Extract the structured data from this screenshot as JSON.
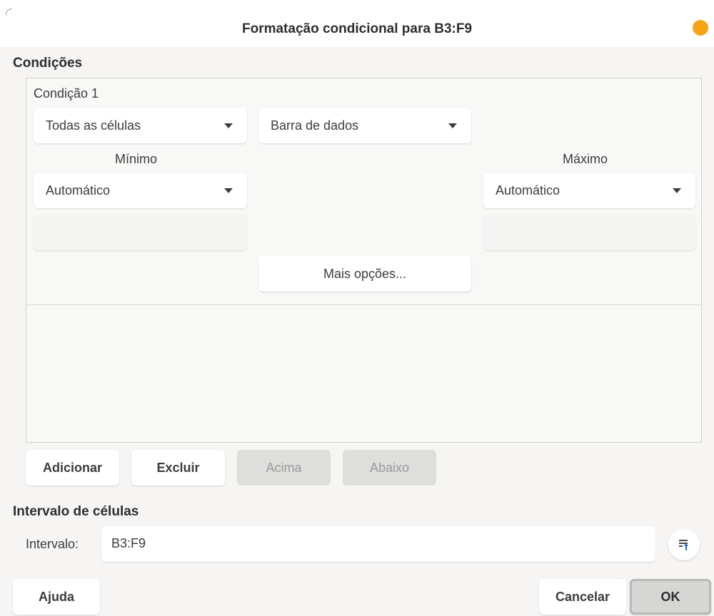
{
  "window": {
    "title": "Formatação condicional para B3:F9"
  },
  "conditions": {
    "section_label": "Condições",
    "condition_title": "Condição 1",
    "applies_to": "Todas as células",
    "style": "Barra de dados",
    "min_label": "Mínimo",
    "min_type": "Automático",
    "min_value": "",
    "max_label": "Máximo",
    "max_type": "Automático",
    "max_value": "",
    "more_options": "Mais opções..."
  },
  "actions": {
    "add": "Adicionar",
    "delete": "Excluir",
    "up": "Acima",
    "down": "Abaixo"
  },
  "range": {
    "section_label": "Intervalo de células",
    "label": "Intervalo:",
    "value": "B3:F9"
  },
  "footer": {
    "help": "Ajuda",
    "cancel": "Cancelar",
    "ok": "OK"
  },
  "colors": {
    "close_dot": "#f6a316",
    "range_icon": "#1e6fd9"
  },
  "icons": {
    "shrink": "shrink-range-icon",
    "dropdown": "chevron-down-icon"
  }
}
